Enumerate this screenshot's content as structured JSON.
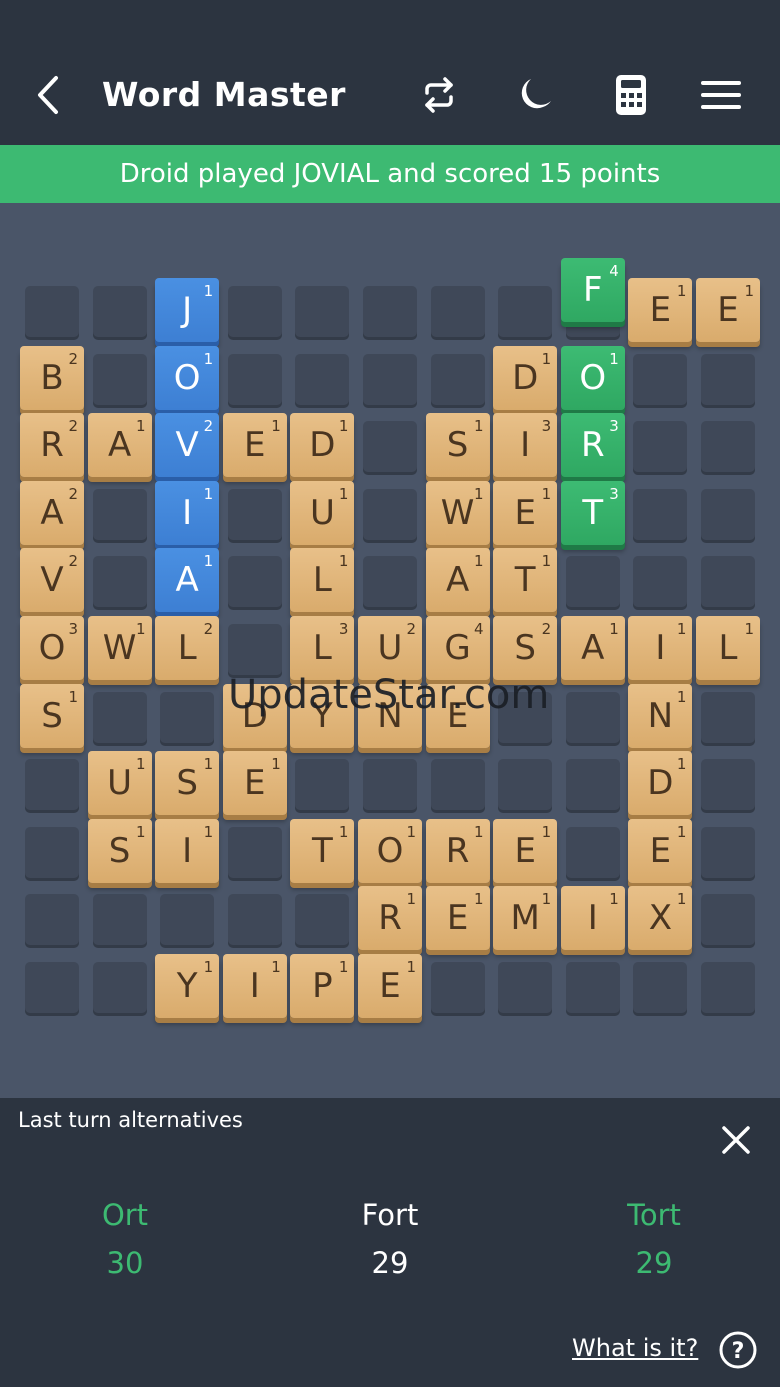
{
  "header": {
    "title": "Word Master"
  },
  "banner": {
    "text": "Droid played JOVIAL and scored 15 points"
  },
  "board": {
    "tiles": [
      {
        "letter": "J",
        "score": "1",
        "col": 2,
        "row": 0,
        "color": "blue"
      },
      {
        "letter": "F",
        "score": "4",
        "col": 8,
        "row": 0,
        "color": "green",
        "lift": 1
      },
      {
        "letter": "E",
        "score": "1",
        "col": 9,
        "row": 0
      },
      {
        "letter": "E",
        "score": "1",
        "col": 10,
        "row": 0
      },
      {
        "letter": "B",
        "score": "2",
        "col": 0,
        "row": 1
      },
      {
        "letter": "O",
        "score": "1",
        "col": 2,
        "row": 1,
        "color": "blue"
      },
      {
        "letter": "D",
        "score": "1",
        "col": 7,
        "row": 1
      },
      {
        "letter": "O",
        "score": "1",
        "col": 8,
        "row": 1,
        "color": "green"
      },
      {
        "letter": "R",
        "score": "2",
        "col": 0,
        "row": 2
      },
      {
        "letter": "A",
        "score": "1",
        "col": 1,
        "row": 2
      },
      {
        "letter": "V",
        "score": "2",
        "col": 2,
        "row": 2,
        "color": "blue"
      },
      {
        "letter": "E",
        "score": "1",
        "col": 3,
        "row": 2
      },
      {
        "letter": "D",
        "score": "1",
        "col": 4,
        "row": 2
      },
      {
        "letter": "S",
        "score": "1",
        "col": 6,
        "row": 2
      },
      {
        "letter": "I",
        "score": "3",
        "col": 7,
        "row": 2
      },
      {
        "letter": "R",
        "score": "3",
        "col": 8,
        "row": 2,
        "color": "green"
      },
      {
        "letter": "A",
        "score": "2",
        "col": 0,
        "row": 3
      },
      {
        "letter": "I",
        "score": "1",
        "col": 2,
        "row": 3,
        "color": "blue"
      },
      {
        "letter": "U",
        "score": "1",
        "col": 4,
        "row": 3
      },
      {
        "letter": "W",
        "score": "1",
        "col": 6,
        "row": 3
      },
      {
        "letter": "E",
        "score": "1",
        "col": 7,
        "row": 3
      },
      {
        "letter": "T",
        "score": "3",
        "col": 8,
        "row": 3,
        "color": "green"
      },
      {
        "letter": "V",
        "score": "2",
        "col": 0,
        "row": 4
      },
      {
        "letter": "A",
        "score": "1",
        "col": 2,
        "row": 4,
        "color": "blue"
      },
      {
        "letter": "L",
        "score": "1",
        "col": 4,
        "row": 4
      },
      {
        "letter": "A",
        "score": "1",
        "col": 6,
        "row": 4
      },
      {
        "letter": "T",
        "score": "1",
        "col": 7,
        "row": 4
      },
      {
        "letter": "O",
        "score": "3",
        "col": 0,
        "row": 5
      },
      {
        "letter": "W",
        "score": "1",
        "col": 1,
        "row": 5
      },
      {
        "letter": "L",
        "score": "2",
        "col": 2,
        "row": 5
      },
      {
        "letter": "L",
        "score": "3",
        "col": 4,
        "row": 5
      },
      {
        "letter": "U",
        "score": "2",
        "col": 5,
        "row": 5
      },
      {
        "letter": "G",
        "score": "4",
        "col": 6,
        "row": 5
      },
      {
        "letter": "S",
        "score": "2",
        "col": 7,
        "row": 5
      },
      {
        "letter": "A",
        "score": "1",
        "col": 8,
        "row": 5
      },
      {
        "letter": "I",
        "score": "1",
        "col": 9,
        "row": 5
      },
      {
        "letter": "L",
        "score": "1",
        "col": 10,
        "row": 5
      },
      {
        "letter": "S",
        "score": "1",
        "col": 0,
        "row": 6
      },
      {
        "letter": "D",
        "score": "",
        "col": 3,
        "row": 6
      },
      {
        "letter": "Y",
        "score": "",
        "col": 4,
        "row": 6
      },
      {
        "letter": "N",
        "score": "",
        "col": 5,
        "row": 6
      },
      {
        "letter": "E",
        "score": "",
        "col": 6,
        "row": 6
      },
      {
        "letter": "N",
        "score": "1",
        "col": 9,
        "row": 6
      },
      {
        "letter": "U",
        "score": "1",
        "col": 1,
        "row": 7
      },
      {
        "letter": "S",
        "score": "1",
        "col": 2,
        "row": 7
      },
      {
        "letter": "E",
        "score": "1",
        "col": 3,
        "row": 7
      },
      {
        "letter": "D",
        "score": "1",
        "col": 9,
        "row": 7
      },
      {
        "letter": "S",
        "score": "1",
        "col": 1,
        "row": 8
      },
      {
        "letter": "I",
        "score": "1",
        "col": 2,
        "row": 8
      },
      {
        "letter": "T",
        "score": "1",
        "col": 4,
        "row": 8
      },
      {
        "letter": "O",
        "score": "1",
        "col": 5,
        "row": 8
      },
      {
        "letter": "R",
        "score": "1",
        "col": 6,
        "row": 8
      },
      {
        "letter": "E",
        "score": "1",
        "col": 7,
        "row": 8
      },
      {
        "letter": "E",
        "score": "1",
        "col": 9,
        "row": 8
      },
      {
        "letter": "R",
        "score": "1",
        "col": 5,
        "row": 9
      },
      {
        "letter": "E",
        "score": "1",
        "col": 6,
        "row": 9
      },
      {
        "letter": "M",
        "score": "1",
        "col": 7,
        "row": 9
      },
      {
        "letter": "I",
        "score": "1",
        "col": 8,
        "row": 9
      },
      {
        "letter": "X",
        "score": "1",
        "col": 9,
        "row": 9
      },
      {
        "letter": "Y",
        "score": "1",
        "col": 2,
        "row": 10
      },
      {
        "letter": "I",
        "score": "1",
        "col": 3,
        "row": 10
      },
      {
        "letter": "P",
        "score": "1",
        "col": 4,
        "row": 10
      },
      {
        "letter": "E",
        "score": "1",
        "col": 5,
        "row": 10
      }
    ]
  },
  "watermark": "UpdateStar.com",
  "panel": {
    "title": "Last turn alternatives",
    "alternatives": [
      {
        "word": "Ort",
        "points": "30",
        "color": "#3dba72"
      },
      {
        "word": "Fort",
        "points": "29",
        "color": "#ffffff"
      },
      {
        "word": "Tort",
        "points": "29",
        "color": "#3dba72"
      }
    ],
    "what_link": "What is it?",
    "help_glyph": "?"
  },
  "icons": [
    "back-arrow-icon",
    "swap-icon",
    "moon-icon",
    "calculator-icon",
    "menu-icon",
    "close-icon",
    "help-icon"
  ]
}
